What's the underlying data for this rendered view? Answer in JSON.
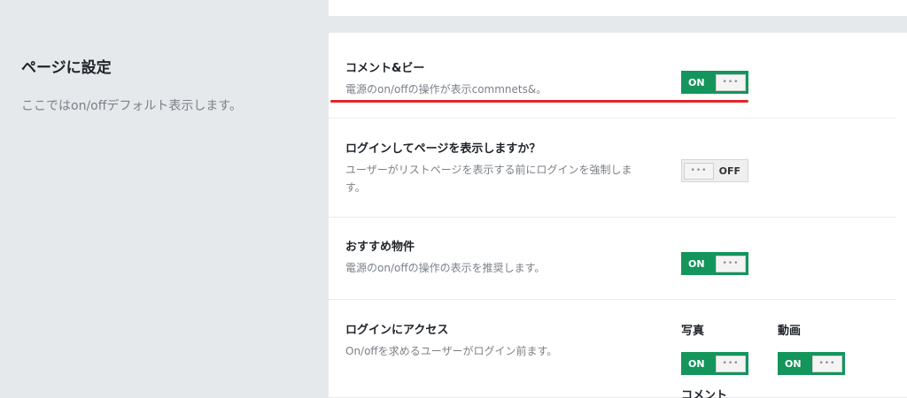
{
  "section": {
    "title": "ページに設定",
    "description": "ここではon/offデフォルト表示します。"
  },
  "settings": [
    {
      "title": "コメント&ビー",
      "description": "電源のon/offの操作が表示commnets&。",
      "toggle": {
        "state": "on",
        "on_label": "ON"
      }
    },
    {
      "title": "ログインしてページを表示しますか？",
      "description": "ユーザーがリストページを表示する前にログインを強制しま す。",
      "toggle": {
        "state": "off",
        "off_label": "OFF"
      }
    },
    {
      "title": "おすすめ物件",
      "description": "電源のon/offの操作の表示を推奨します。",
      "toggle": {
        "state": "on",
        "on_label": "ON"
      }
    },
    {
      "title": "ログインにアクセス",
      "description": "On/offを求めるユーザーがログイン前ます。",
      "sub_toggles": [
        {
          "label": "写真",
          "state": "on",
          "on_label": "ON"
        },
        {
          "label": "動画",
          "state": "on",
          "on_label": "ON"
        }
      ],
      "partial_label": "コメント"
    }
  ],
  "toggle_knob_glyph": "•••",
  "colors": {
    "toggle_on": "#13955c",
    "highlight_underline": "#e0252a",
    "background": "#e6e9ec"
  }
}
